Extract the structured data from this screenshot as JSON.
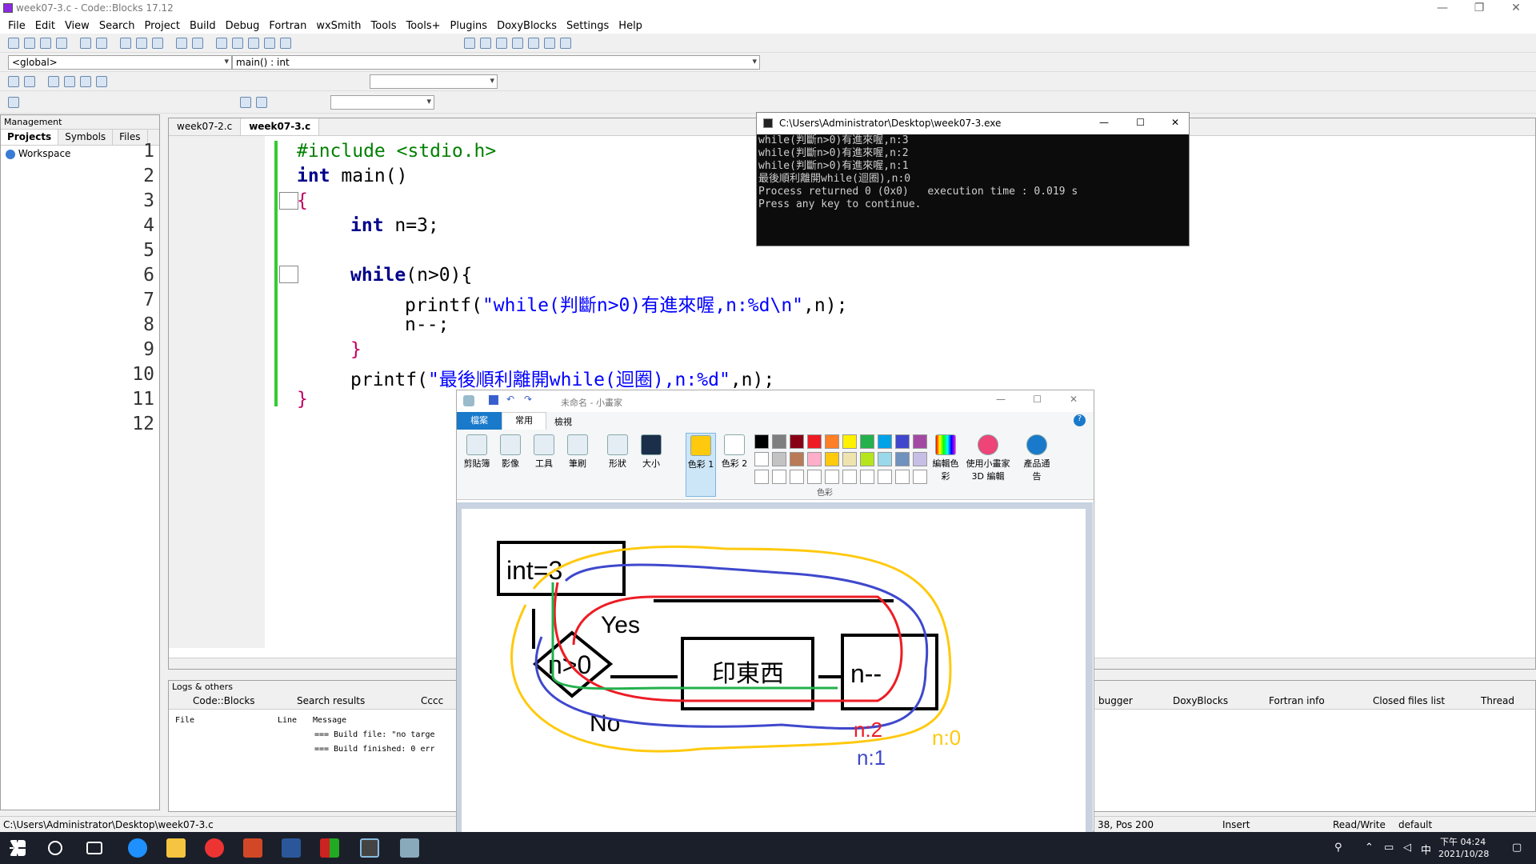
{
  "window_title": "week07-3.c - Code::Blocks 17.12",
  "menu": [
    "File",
    "Edit",
    "View",
    "Search",
    "Project",
    "Build",
    "Debug",
    "Fortran",
    "wxSmith",
    "Tools",
    "Tools+",
    "Plugins",
    "DoxyBlocks",
    "Settings",
    "Help"
  ],
  "scope_combo": "<global>",
  "func_combo": "main() : int",
  "management": {
    "title": "Management",
    "tabs": [
      "Projects",
      "Symbols",
      "Files"
    ],
    "workspace": "Workspace"
  },
  "editor": {
    "tabs": [
      "week07-2.c",
      "week07-3.c"
    ],
    "lines": [
      "1",
      "2",
      "3",
      "4",
      "5",
      "6",
      "7",
      "8",
      "9",
      "10",
      "11",
      "12"
    ]
  },
  "code": {
    "l1": "#include <stdio.h>",
    "l2a": "int",
    "l2b": " main()",
    "l3": "{",
    "l4a": "int",
    "l4b": " n=3;",
    "l6a": "while",
    "l6b": "(n>0){",
    "l7a": "printf(",
    "l7b": "\"while(判斷n>0)有進來喔,n:%d\\n\"",
    "l7c": ",n);",
    "l8": "n--;",
    "l9": "}",
    "l10a": "printf(",
    "l10b": "\"最後順利離開while(迴圈),n:%d\"",
    "l10c": ",n);",
    "l11": "}"
  },
  "logs": {
    "title": "Logs & others",
    "tabs": [
      "Code::Blocks",
      "Search results",
      "Cccc",
      "bugger",
      "DoxyBlocks",
      "Fortran info",
      "Closed files list",
      "Thread"
    ],
    "cols": [
      "File",
      "Line",
      "Message"
    ],
    "msgs": [
      "=== Build file: \"no targe",
      "=== Build finished: 0 err"
    ]
  },
  "status": {
    "path": "C:\\Users\\Administrator\\Desktop\\week07-3.c",
    "pos": "38, Pos 200",
    "mode": "Insert",
    "rw": "Read/Write",
    "def": "default"
  },
  "console": {
    "title": "C:\\Users\\Administrator\\Desktop\\week07-3.exe",
    "lines": [
      "while(判斷n>0)有進來喔,n:3",
      "while(判斷n>0)有進來喔,n:2",
      "while(判斷n>0)有進來喔,n:1",
      "最後順利離開while(迴圈),n:0",
      "Process returned 0 (0x0)   execution time : 0.019 s",
      "Press any key to continue."
    ]
  },
  "paint": {
    "title": "未命名 - 小畫家",
    "tabs": [
      "檔案",
      "常用",
      "檢視"
    ],
    "groups": [
      "剪貼簿",
      "影像",
      "工具",
      "筆刷",
      "形狀",
      "大小",
      "色彩 1",
      "色彩 2",
      "編輯色彩",
      "使用小畫家 3D 編輯",
      "產品通告"
    ],
    "colors_label": "色彩",
    "palette": [
      "#000000",
      "#7f7f7f",
      "#880015",
      "#ed1c24",
      "#ff7f27",
      "#fff200",
      "#22b14c",
      "#00a2e8",
      "#3f48cc",
      "#a349a4",
      "#ffffff",
      "#c3c3c3",
      "#b97a57",
      "#ffaec9",
      "#ffc90e",
      "#efe4b0",
      "#b5e61d",
      "#99d9ea",
      "#7092be",
      "#c8bfe7"
    ],
    "drawing": {
      "box1": "int=3",
      "yes": "Yes",
      "no": "No",
      "diamond": "n>0",
      "box2": "印東西",
      "box3": "n--",
      "n2": "n:2",
      "n1": "n:1",
      "n0": "n:0"
    }
  },
  "clock": {
    "time": "下午 04:24",
    "date": "2021/10/28",
    "ime": "中"
  }
}
